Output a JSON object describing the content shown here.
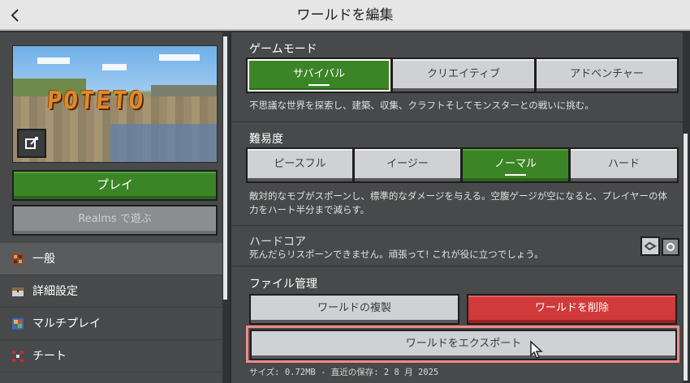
{
  "header": {
    "title": "ワールドを編集",
    "back_icon": "chevron-left-icon"
  },
  "world": {
    "sign_text": "POTETO",
    "edit_icon": "edit-thumbnail-icon"
  },
  "left": {
    "play_label": "プレイ",
    "realms_label": "Realms で遊ぶ",
    "nav": [
      {
        "label": "一般",
        "icon": "general-block-icon",
        "active": true
      },
      {
        "label": "詳細設定",
        "icon": "advanced-chest-icon",
        "active": false
      },
      {
        "label": "マルチプレイ",
        "icon": "multiplayer-icon",
        "active": false
      },
      {
        "label": "チート",
        "icon": "cheats-icon",
        "active": false
      }
    ]
  },
  "game_mode": {
    "label": "ゲームモード",
    "options": [
      "サバイバル",
      "クリエイティブ",
      "アドベンチャー"
    ],
    "selected": "サバイバル",
    "description": "不思議な世界を探索し、建築、収集、クラフトそしてモンスターとの戦いに挑む。"
  },
  "difficulty": {
    "label": "難易度",
    "options": [
      "ピースフル",
      "イージー",
      "ノーマル",
      "ハード"
    ],
    "selected": "ノーマル",
    "description": "敵対的なモブがスポーンし、標準的なダメージを与える。空腹ゲージが空になると、プレイヤーの体力をハート半分まで減らす。"
  },
  "hardcore": {
    "label": "ハードコア",
    "description": "死んだらリスポーンできません。頑張って! これが役に立つでしょう。",
    "enabled": false
  },
  "file_management": {
    "label": "ファイル管理",
    "copy_label": "ワールドの複製",
    "delete_label": "ワールドを削除",
    "export_label": "ワールドをエクスポート",
    "info": "サイズ: 0.72MB - 直近の保存: 2 8 月 2025"
  },
  "colors": {
    "green": "#3c8527",
    "red": "#d03a3a",
    "highlight": "#f08a8a"
  }
}
